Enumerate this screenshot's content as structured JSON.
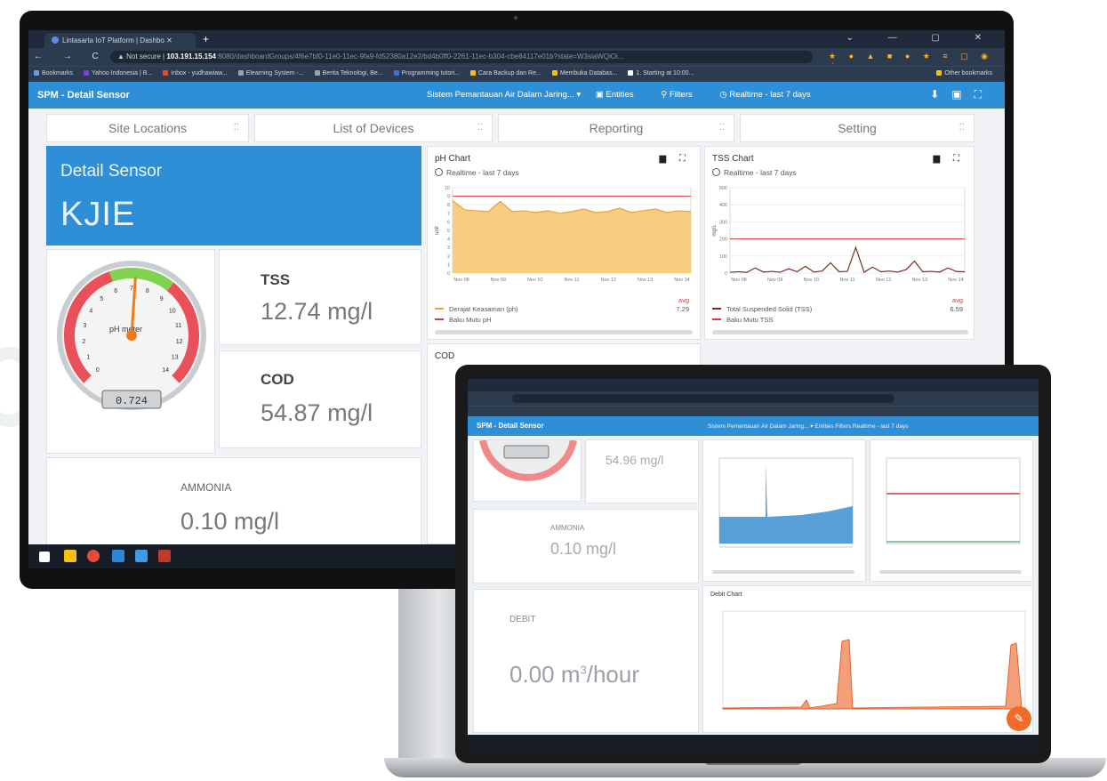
{
  "browser": {
    "tab_title": "Lintasarta IoT Platform | Dashbo",
    "new_tab": "+",
    "window_controls": "⌄ — ▢ ✕",
    "nav_buttons": "← → C",
    "not_secure": "▲ Not secure |",
    "host": "103.191.15.154",
    "path": ":8080/dashboardGroups/4f6e7bf0-11e0-11ec-9fa9-fd52380a12e2/bd4b0ff0-2261-11ec-b304-cbe84117e01b?state=W3siaWQiOi...",
    "bookmarks": [
      {
        "label": "Bookmarks",
        "color": "#6b9be0"
      },
      {
        "label": "Yahoo Indonesia | B...",
        "color": "#7b3fe4"
      },
      {
        "label": "Inbox - yudhawiaw...",
        "color": "#e44b3a"
      },
      {
        "label": "Elearning System -...",
        "color": "#9aa3ad"
      },
      {
        "label": "Berita Teknologi, Be...",
        "color": "#9aa3ad"
      },
      {
        "label": "Programming tutori...",
        "color": "#3f6fd8"
      },
      {
        "label": "Cara Backup dan Re...",
        "color": "#f4c20d"
      },
      {
        "label": "Membuka Databas...",
        "color": "#f4c20d"
      },
      {
        "label": "1. Starting at 10:00...",
        "color": "#ffffff"
      }
    ],
    "other_bookmarks": "Other bookmarks"
  },
  "dashboard": {
    "title": "SPM - Detail Sensor",
    "group": "Sistem Pemantauan Air Dalam Jaring... ▾",
    "entities": "Entities",
    "filters": "Filters",
    "timewindow": "Realtime - last 7 days",
    "nav": [
      "Site Locations",
      "List of Devices",
      "Reporting",
      "Setting"
    ],
    "nav_dots": "⁚⁚",
    "detail": {
      "heading": "Detail Sensor",
      "name": "KJIE"
    },
    "gauge": {
      "label": "pH meter",
      "readout": "0.724",
      "ticks": [
        "0",
        "1",
        "2",
        "3",
        "4",
        "5",
        "6",
        "7",
        "8",
        "9",
        "10",
        "11",
        "12",
        "13",
        "14"
      ],
      "value": 7.2
    },
    "tss": {
      "title": "TSS",
      "value": "12.74 mg/l"
    },
    "cod": {
      "title": "COD",
      "value": "54.87 mg/l"
    },
    "ammonia": {
      "title": "AMMONIA",
      "value": "0.10 mg/l"
    },
    "cod_chart_title": "COD",
    "colors": {
      "primary": "#2f8fd6",
      "ph_area": "#f6c56a",
      "ph_line": "#e8a33a",
      "limit": "#d9363e",
      "tss_line": "#7a2e20"
    }
  },
  "ph_chart": {
    "title": "pH Chart",
    "subtitle": "Realtime - last 7 days",
    "ylabel": "unit",
    "yticks": [
      "10",
      "9",
      "8",
      "7",
      "6",
      "5",
      "4",
      "3",
      "2",
      "1",
      "0"
    ],
    "xticks": [
      "Nov 08",
      "Nov 09",
      "Nov 10",
      "Nov 11",
      "Nov 12",
      "Nov 13",
      "Nov 14"
    ],
    "legend_header": "avg",
    "legend": [
      {
        "name": "Derajat Keasaman (ph)",
        "value": "7.29",
        "color": "#e8a33a"
      },
      {
        "name": "Baku Mutu pH",
        "value": "",
        "color": "#d9363e"
      }
    ]
  },
  "tss_chart": {
    "title": "TSS Chart",
    "subtitle": "Realtime - last 7 days",
    "ylabel": "mg/L",
    "yticks": [
      "500",
      "400",
      "300",
      "200",
      "100",
      "0"
    ],
    "xticks": [
      "Nov 08",
      "Nov 09",
      "Nov 10",
      "Nov 11",
      "Nov 12",
      "Nov 13",
      "Nov 14"
    ],
    "legend_header": "avg",
    "legend": [
      {
        "name": "Total Suspended Solid (TSS)",
        "value": "6.59",
        "color": "#7a2e20"
      },
      {
        "name": "Baku Mutu TSS",
        "value": "",
        "color": "#d9363e"
      }
    ]
  },
  "chart_data": [
    {
      "type": "area",
      "title": "pH Chart",
      "ylabel": "unit",
      "ylim": [
        0,
        10
      ],
      "x": [
        "Nov 08",
        "Nov 09",
        "Nov 10",
        "Nov 11",
        "Nov 12",
        "Nov 13",
        "Nov 14"
      ],
      "series": [
        {
          "name": "Derajat Keasaman (ph)",
          "values": [
            8.5,
            7.4,
            7.3,
            7.2,
            8.4,
            7.2,
            7.3,
            7.1,
            7.3,
            7.0,
            7.2,
            7.5,
            7.1,
            7.2,
            7.6,
            7.1,
            7.3,
            7.5,
            7.1,
            7.3,
            7.2
          ]
        },
        {
          "name": "Baku Mutu pH",
          "values": [
            9,
            9
          ]
        }
      ]
    },
    {
      "type": "line",
      "title": "TSS Chart",
      "ylabel": "mg/L",
      "ylim": [
        0,
        500
      ],
      "x": [
        "Nov 08",
        "Nov 09",
        "Nov 10",
        "Nov 11",
        "Nov 12",
        "Nov 13",
        "Nov 14"
      ],
      "series": [
        {
          "name": "Total Suspended Solid (TSS)",
          "values": [
            5,
            8,
            4,
            30,
            6,
            10,
            5,
            25,
            8,
            40,
            6,
            12,
            60,
            8,
            10,
            150,
            5,
            35,
            8,
            12,
            6,
            20,
            70,
            8,
            10,
            6,
            30,
            9,
            8
          ]
        },
        {
          "name": "Baku Mutu TSS",
          "values": [
            200,
            200
          ]
        }
      ]
    }
  ],
  "laptop": {
    "title": "SPM - Detail Sensor",
    "menu": "Sistem Pemantauan Air Dalam Jaring... ▾   Entities   Filters   Realtime - last 7 days",
    "cod_value": "54.96 mg/l",
    "ammonia_title": "AMMONIA",
    "ammonia_value": "0.10 mg/l",
    "debit_title": "DEBIT",
    "debit_value": "0.00 m",
    "debit_sup": "3",
    "debit_unit": "/hour",
    "debit_chart_title": "Debit Chart",
    "fab": "✎"
  }
}
